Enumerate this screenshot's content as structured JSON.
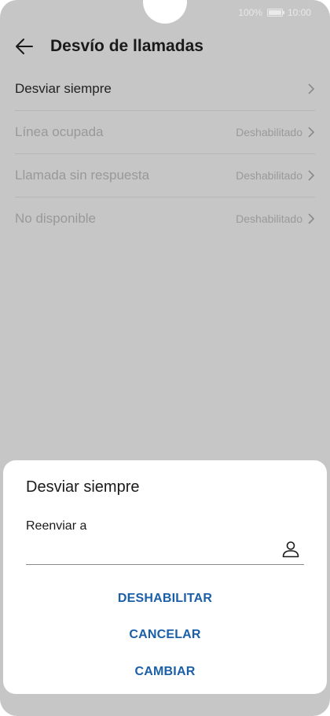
{
  "status": {
    "battery": "100%",
    "time": "10:00"
  },
  "header": {
    "title": "Desvío de llamadas",
    "back_icon": "arrow-left-icon"
  },
  "list": {
    "items": [
      {
        "label": "Desviar siempre",
        "value": "",
        "enabled": true
      },
      {
        "label": "Línea ocupada",
        "value": "Deshabilitado",
        "enabled": false
      },
      {
        "label": "Llamada sin respuesta",
        "value": "Deshabilitado",
        "enabled": false
      },
      {
        "label": "No disponible",
        "value": "Deshabilitado",
        "enabled": false
      }
    ]
  },
  "dialog": {
    "title": "Desviar siempre",
    "field_label": "Reenviar a",
    "field_value": "",
    "contact_icon": "person-icon",
    "buttons": {
      "disable": "DESHABILITAR",
      "cancel": "CANCELAR",
      "change": "CAMBIAR"
    }
  },
  "colors": {
    "accent": "#1a5fa8",
    "overlay_background": "#c6c6c6"
  }
}
